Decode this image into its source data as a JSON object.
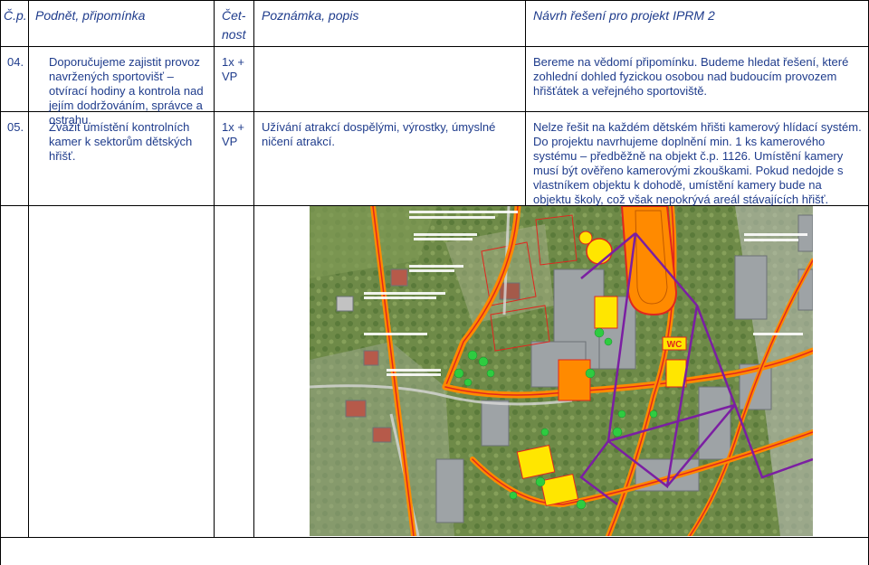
{
  "header": {
    "col_num": "Č.p.",
    "col_suggestion": "Podnět, připomínka",
    "col_frequency_1": "Čet-",
    "col_frequency_2": "nost",
    "col_note": "Poznámka, popis",
    "col_proposal": "Návrh řešení pro projekt IPRM 2"
  },
  "rows": [
    {
      "num": "04.",
      "suggestion": "Doporučujeme zajistit provoz navržených sportovišť – otvírací hodiny a kontrola nad jejím dodržováním, správce a ostrahu.",
      "frequency_1": "1x +",
      "frequency_2": "VP",
      "note": "",
      "proposal": "Bereme na vědomí připomínku. Budeme hledat řešení, které zohlední dohled fyzickou osobou nad budoucím provozem hřišťátek a veřejného sportoviště."
    },
    {
      "num": "05.",
      "suggestion": "Zvážit umístění kontrolních kamer k sektorům dětských hřišť.",
      "frequency_1": "1x +",
      "frequency_2": "VP",
      "note": "Užívání atrakcí dospělými, výrostky, úmyslné ničení atrakcí.",
      "proposal_1": "Nelze řešit na každém dětském hřišti kamerový hlídací systém.",
      "proposal_2": "Do projektu navrhujeme doplnění min. 1 ks kamerového systému – předběžně na objekt č.p. 1126. Umístění kamery musí být ověřeno kamerovými zkouškami. Pokud nedojde s vlastníkem objektu k dohodě, umístění kamery bude na objektu školy, což však nepokrývá areál stávajících hřišť."
    }
  ],
  "map": {
    "wc_label": "WC",
    "colors": {
      "orange_route": "#ff8a00",
      "red_line": "#e0271f",
      "purple_camera": "#7b1fa2",
      "yellow_area": "#ffe600",
      "green_tree": "#2ecc40"
    }
  }
}
